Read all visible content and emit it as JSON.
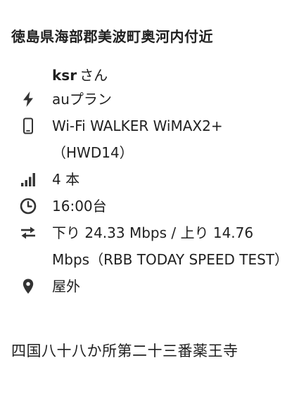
{
  "location": {
    "title": "徳島県海部郡美波町奥河内付近"
  },
  "user": {
    "name": "ksr",
    "suffix": "さん"
  },
  "plan": {
    "label": "auプラン",
    "icon": "lightning-icon"
  },
  "device": {
    "line1": "Wi-Fi WALKER WiMAX2+",
    "line2": "（HWD14）",
    "icon": "phone-icon"
  },
  "signal": {
    "label": "4 本",
    "icon": "signal-bars-icon"
  },
  "time": {
    "label": "16:00台",
    "icon": "clock-icon"
  },
  "speed": {
    "label": "下り 24.33 Mbps / 上り 14.76 Mbps（RBB TODAY SPEED TEST）",
    "icon": "transfer-arrows-icon"
  },
  "place": {
    "label": "屋外",
    "icon": "map-pin-icon"
  },
  "caption": {
    "text": "四国八十八か所第二十三番薬王寺"
  },
  "colors": {
    "text": "#1f1f1f",
    "icon": "#333333",
    "background": "#ffffff"
  }
}
